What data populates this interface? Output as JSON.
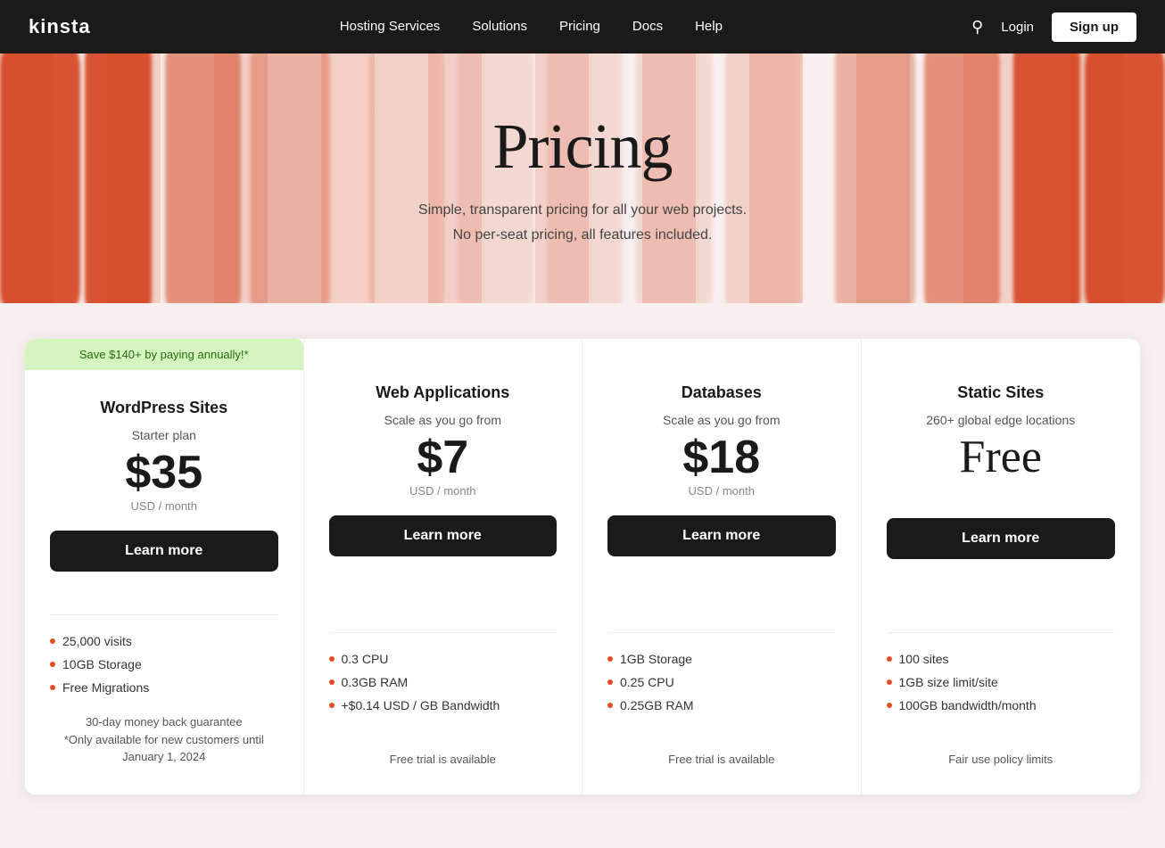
{
  "nav": {
    "logo": "kinsta",
    "links": [
      {
        "label": "Hosting Services"
      },
      {
        "label": "Solutions"
      },
      {
        "label": "Pricing"
      },
      {
        "label": "Docs"
      },
      {
        "label": "Help"
      }
    ],
    "login_label": "Login",
    "signup_label": "Sign up"
  },
  "hero": {
    "title": "Pricing",
    "subtitle_line1": "Simple, transparent pricing for all your web projects.",
    "subtitle_line2": "No per-seat pricing, all features included."
  },
  "pricing": {
    "save_badge": "Save $140+ by paying annually!*",
    "cards": [
      {
        "id": "wordpress",
        "category": "WordPress Sites",
        "plan_sub": "Starter plan",
        "price": "$35",
        "price_meta": "USD  / month",
        "btn_label": "Learn more",
        "features": [
          "25,000 visits",
          "10GB Storage",
          "Free Migrations"
        ],
        "footer_text": "30-day money back guarantee",
        "footer_note": "*Only available for new customers until January 1, 2024",
        "free_trial": ""
      },
      {
        "id": "web-apps",
        "category": "Web Applications",
        "plan_sub": "Scale as you go from",
        "price": "$7",
        "price_meta": "USD  / month",
        "btn_label": "Learn more",
        "features": [
          "0.3 CPU",
          "0.3GB RAM",
          "+$0.14 USD / GB Bandwidth"
        ],
        "footer_text": "",
        "footer_note": "",
        "free_trial": "Free trial is available"
      },
      {
        "id": "databases",
        "category": "Databases",
        "plan_sub": "Scale as you go from",
        "price": "$18",
        "price_meta": "USD  / month",
        "btn_label": "Learn more",
        "features": [
          "1GB Storage",
          "0.25 CPU",
          "0.25GB RAM"
        ],
        "footer_text": "",
        "footer_note": "",
        "free_trial": "Free trial is available"
      },
      {
        "id": "static-sites",
        "category": "Static Sites",
        "plan_sub": "260+ global edge locations",
        "price": "Free",
        "price_meta": "",
        "btn_label": "Learn more",
        "features": [
          "100 sites",
          "1GB size limit/site",
          "100GB bandwidth/month"
        ],
        "footer_text": "",
        "footer_note": "",
        "free_trial": "Fair use policy limits"
      }
    ]
  }
}
